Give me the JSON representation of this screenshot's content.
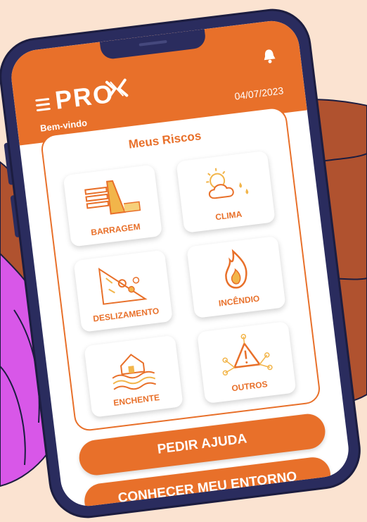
{
  "header": {
    "logo": "PRO",
    "date": "04/07/2023",
    "welcome": "Bem-vindo"
  },
  "risks": {
    "title": "Meus Riscos",
    "tiles": [
      {
        "label": "BARRAGEM",
        "icon": "dam-icon"
      },
      {
        "label": "CLIMA",
        "icon": "weather-icon"
      },
      {
        "label": "DESLIZAMENTO",
        "icon": "landslide-icon"
      },
      {
        "label": "INCÊNDIO",
        "icon": "fire-icon"
      },
      {
        "label": "ENCHENTE",
        "icon": "flood-icon"
      },
      {
        "label": "OUTROS",
        "icon": "network-warning-icon"
      }
    ]
  },
  "actions": {
    "help": "PEDIR AJUDA",
    "surroundings": "CONHECER MEU ENTORNO"
  },
  "colors": {
    "accent": "#e8702a",
    "phone": "#2a2c5e",
    "background": "#fbe3d1",
    "hand": "#b0522f",
    "sleeve": "#d857e8"
  }
}
